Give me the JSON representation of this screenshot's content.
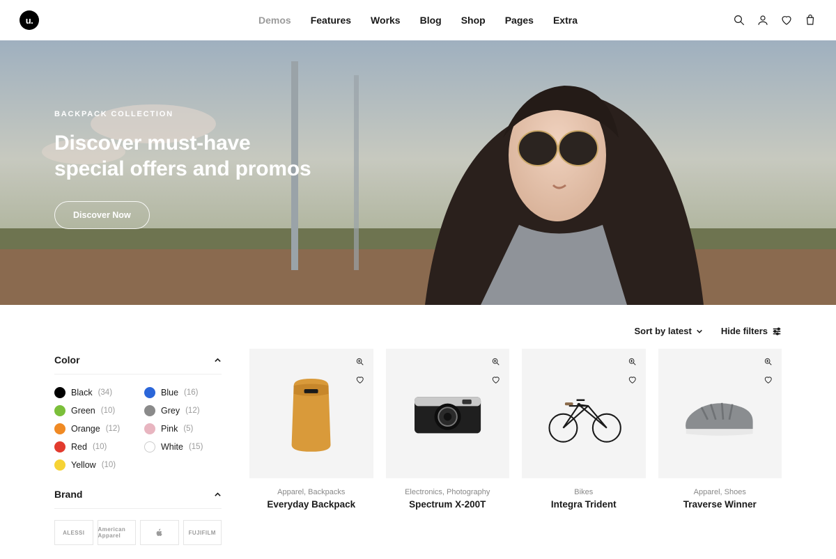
{
  "logo": "u.",
  "nav": [
    {
      "label": "Demos",
      "muted": true
    },
    {
      "label": "Features",
      "muted": false
    },
    {
      "label": "Works",
      "muted": false
    },
    {
      "label": "Blog",
      "muted": false
    },
    {
      "label": "Shop",
      "muted": false
    },
    {
      "label": "Pages",
      "muted": false
    },
    {
      "label": "Extra",
      "muted": false
    }
  ],
  "hero": {
    "eyebrow": "BACKPACK COLLECTION",
    "title_l1": "Discover must-have",
    "title_l2": "special offers and promos",
    "cta": "Discover Now"
  },
  "toolbar": {
    "sort": "Sort by latest",
    "hide": "Hide filters"
  },
  "filters": {
    "color": {
      "title": "Color",
      "items": [
        {
          "name": "Black",
          "count": "(34)",
          "hex": "#000000"
        },
        {
          "name": "Blue",
          "count": "(16)",
          "hex": "#2b66d9"
        },
        {
          "name": "Green",
          "count": "(10)",
          "hex": "#7bbf3a"
        },
        {
          "name": "Grey",
          "count": "(12)",
          "hex": "#8a8a8a"
        },
        {
          "name": "Orange",
          "count": "(12)",
          "hex": "#f08a24"
        },
        {
          "name": "Pink",
          "count": "(5)",
          "hex": "#e8b5c0"
        },
        {
          "name": "Red",
          "count": "(10)",
          "hex": "#e23b2e"
        },
        {
          "name": "White",
          "count": "(15)",
          "hex": "#ffffff",
          "border": true
        },
        {
          "name": "Yellow",
          "count": "(10)",
          "hex": "#f6d335"
        }
      ]
    },
    "brand": {
      "title": "Brand",
      "items": [
        "ALESSI",
        "American Apparel",
        "",
        "FUJIFILM"
      ]
    }
  },
  "products": [
    {
      "meta": "Apparel, Backpacks",
      "title": "Everyday Backpack"
    },
    {
      "meta": "Electronics, Photography",
      "title": "Spectrum X-200T"
    },
    {
      "meta": "Bikes",
      "title": "Integra Trident"
    },
    {
      "meta": "Apparel, Shoes",
      "title": "Traverse Winner"
    }
  ]
}
